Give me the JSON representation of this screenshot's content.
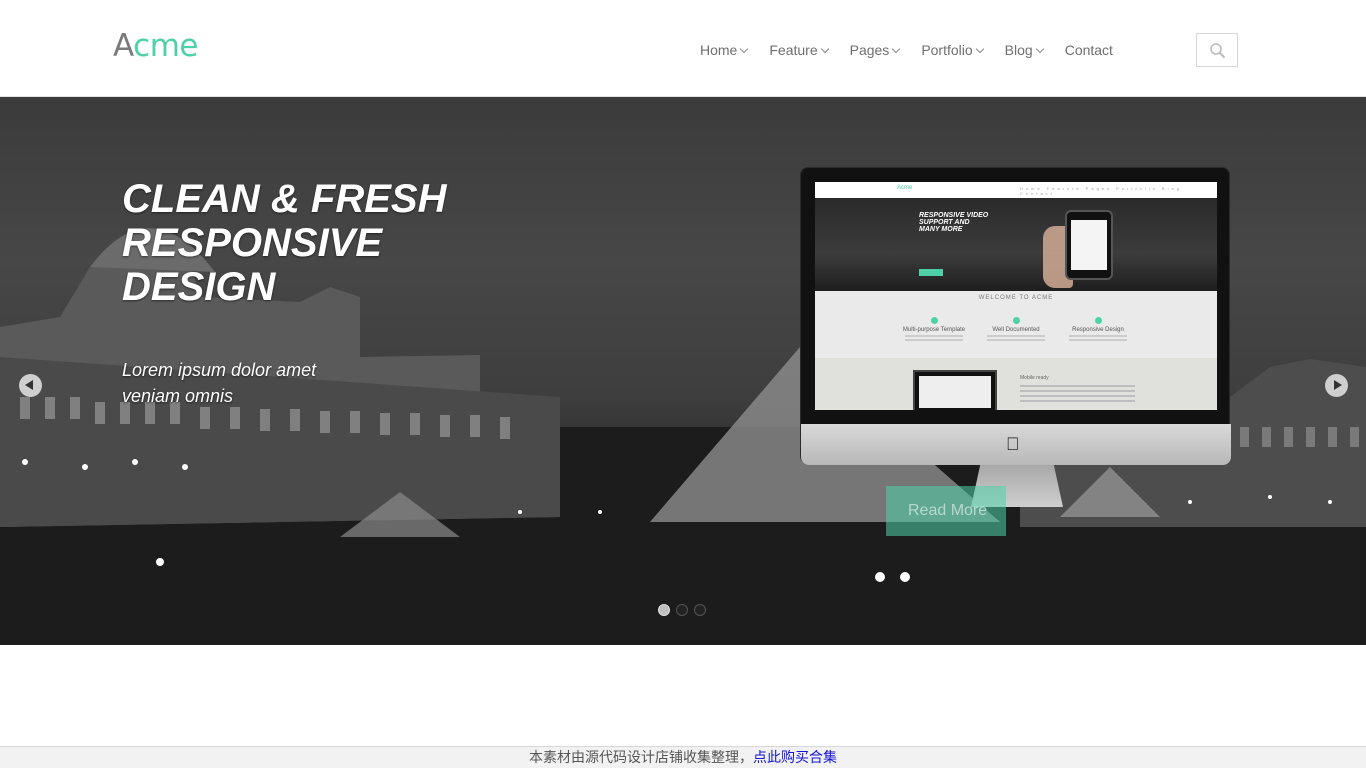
{
  "brand": {
    "logo_first": "A",
    "logo_rest": "cme",
    "accent": "#4fd1a8"
  },
  "nav": {
    "items": [
      {
        "label": "Home",
        "has_dropdown": true
      },
      {
        "label": "Feature",
        "has_dropdown": true
      },
      {
        "label": "Pages",
        "has_dropdown": true
      },
      {
        "label": "Portfolio",
        "has_dropdown": true
      },
      {
        "label": "Blog",
        "has_dropdown": true
      },
      {
        "label": "Contact",
        "has_dropdown": false
      }
    ],
    "search_icon": "search-icon"
  },
  "hero": {
    "title_lines": [
      "CLEAN & FRESH",
      "RESPONSIVE",
      "DESIGN"
    ],
    "subtitle_lines": [
      "Lorem ipsum dolor amet",
      "veniam omnis"
    ],
    "prev_icon": "chevron-left-icon",
    "next_icon": "chevron-right-icon",
    "slide_count": 3,
    "active_slide": 1,
    "ghost_button": "Read More"
  },
  "mockup": {
    "logo": "Acme",
    "hero_text": [
      "RESPONSIVE VIDEO",
      "SUPPORT AND",
      "MANY MORE"
    ],
    "welcome": "WELCOME TO ACME",
    "features": [
      "Multi-purpose Template",
      "Well Documented",
      "Responsive Design"
    ],
    "section_heading": "Mobile ready",
    "nav_links": "Home Feature Pages Portfolio Blog Contact"
  },
  "notice": {
    "text": "本素材由源代码设计店铺收集整理，",
    "link": "点此购买合集"
  }
}
